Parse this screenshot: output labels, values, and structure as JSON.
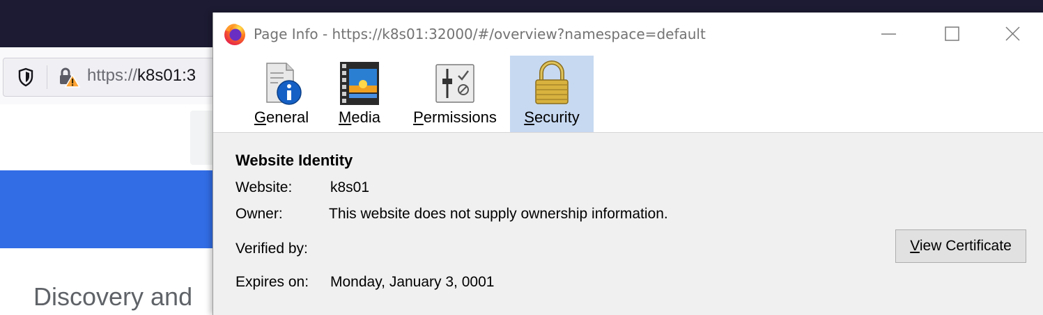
{
  "browser": {
    "url_prefix": "https://",
    "url_host": "k8s01:3",
    "page_heading": "Discovery and",
    "colors": {
      "titlebar": "#1c1b33",
      "banner": "#326de6"
    }
  },
  "dialog": {
    "title": "Page Info - https://k8s01:32000/#/overview?namespace=default",
    "tabs": [
      {
        "label": "General",
        "accel": "G",
        "rest": "eneral",
        "icon": "info-icon"
      },
      {
        "label": "Media",
        "accel": "M",
        "rest": "edia",
        "icon": "media-icon"
      },
      {
        "label": "Permissions",
        "accel": "P",
        "rest": "ermissions",
        "icon": "permissions-icon"
      },
      {
        "label": "Security",
        "accel": "S",
        "rest": "ecurity",
        "icon": "padlock-icon",
        "selected": true
      }
    ],
    "security": {
      "section_title": "Website Identity",
      "website_label": "Website:",
      "website_value": "k8s01",
      "owner_label": "Owner:",
      "owner_value": "This website does not supply ownership information.",
      "verified_label": "Verified by:",
      "expires_label": "Expires on:",
      "expires_value": "Monday, January 3, 0001",
      "view_cert_accel": "V",
      "view_cert_rest": "iew Certificate"
    },
    "colors": {
      "selected_tab": "#c7d9f1",
      "background": "#f0f0f0"
    }
  }
}
